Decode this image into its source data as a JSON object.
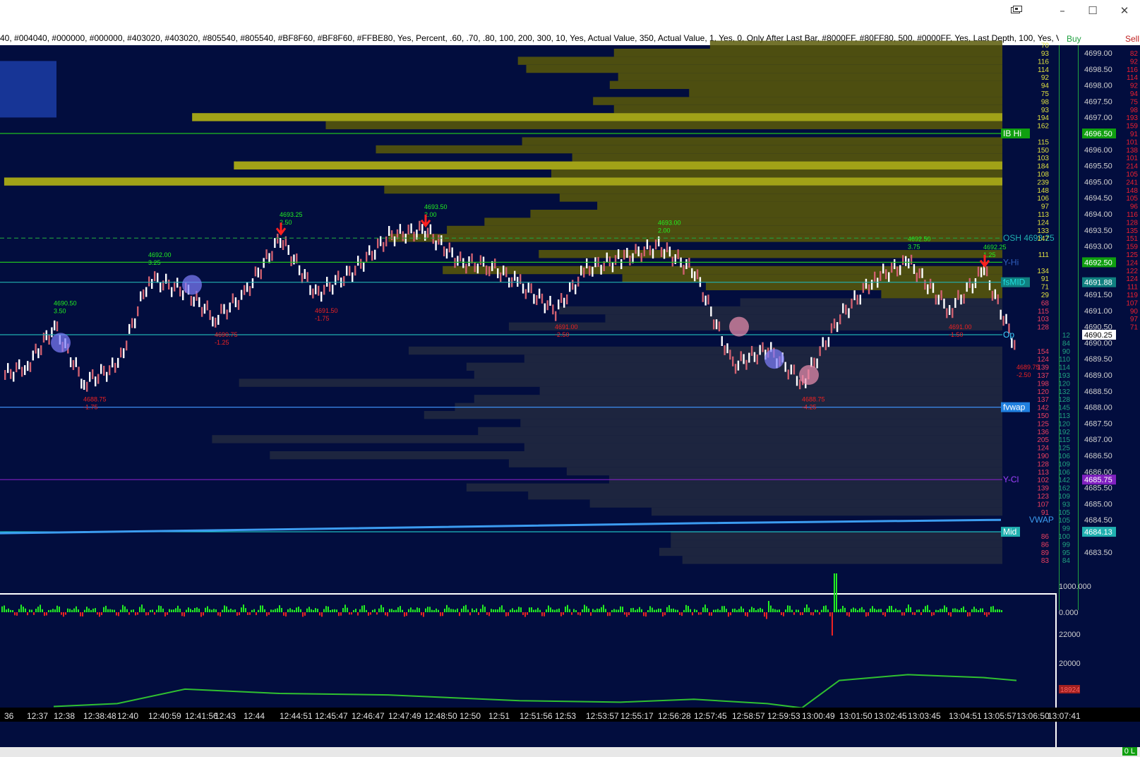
{
  "window": {
    "icon": "window-cascade-icon",
    "minimize": "–",
    "maximize": "☐",
    "close": "✕"
  },
  "settings_string": "40, #004040, #000000, #000000, #403020, #403020, #805540, #805540, #BF8F60, #BF8F60, #FFBE80, Yes, Percent, .60, .70, .80, 100, 200, 300, 10, Yes, Actual Value, 350, Actual Value, 1, Yes, 0, Only After Last Bar, #8000FF, #80FF80, 500, #0000FF, Yes, Last Depth, 100, Yes, Visible Bars, 0, 60, 1, (",
  "headers": {
    "buy": "Buy",
    "sell": "Sell"
  },
  "colors": {
    "background": "#020d3e",
    "profile": "#5a5a08",
    "profile_hot": "#bdbd10",
    "line_green": "#20c020",
    "line_cyan": "#20b0b0",
    "vwap": "#3c9cf0",
    "pos": "#22ee22",
    "neg": "#ee2222",
    "up": "#ffffff",
    "down": "#d06070"
  },
  "price_axis": [
    {
      "p": 4699.0,
      "t": "4699.00"
    },
    {
      "p": 4698.5,
      "t": "4698.50"
    },
    {
      "p": 4698.0,
      "t": "4698.00"
    },
    {
      "p": 4697.5,
      "t": "4697.50"
    },
    {
      "p": 4697.0,
      "t": "4697.00"
    },
    {
      "p": 4696.0,
      "t": "4696.00"
    },
    {
      "p": 4695.5,
      "t": "4695.50"
    },
    {
      "p": 4695.0,
      "t": "4695.00"
    },
    {
      "p": 4694.5,
      "t": "4694.50"
    },
    {
      "p": 4694.0,
      "t": "4694.00"
    },
    {
      "p": 4693.5,
      "t": "4693.50"
    },
    {
      "p": 4693.0,
      "t": "4693.00"
    },
    {
      "p": 4691.5,
      "t": "4691.50"
    },
    {
      "p": 4691.0,
      "t": "4691.00"
    },
    {
      "p": 4690.5,
      "t": "4690.50"
    },
    {
      "p": 4690.0,
      "t": "4690.00"
    },
    {
      "p": 4689.5,
      "t": "4689.50"
    },
    {
      "p": 4689.0,
      "t": "4689.00"
    },
    {
      "p": 4688.5,
      "t": "4688.50"
    },
    {
      "p": 4688.0,
      "t": "4688.00"
    },
    {
      "p": 4687.5,
      "t": "4687.50"
    },
    {
      "p": 4687.0,
      "t": "4687.00"
    },
    {
      "p": 4686.5,
      "t": "4686.50"
    },
    {
      "p": 4686.0,
      "t": "4686.00"
    },
    {
      "p": 4685.5,
      "t": "4685.50"
    },
    {
      "p": 4685.0,
      "t": "4685.00"
    },
    {
      "p": 4684.5,
      "t": "4684.50"
    },
    {
      "p": 4683.5,
      "t": "4683.50"
    }
  ],
  "price_tags": [
    {
      "p": 4696.5,
      "t": "4696.50",
      "bg": "#10a010",
      "fg": "#ffffff"
    },
    {
      "p": 4692.5,
      "t": "4692.50",
      "bg": "#10a010",
      "fg": "#ffffff"
    },
    {
      "p": 4691.88,
      "t": "4691.88",
      "bg": "#108080",
      "fg": "#ffffff"
    },
    {
      "p": 4690.25,
      "t": "4690.25",
      "bg": "#ffffff",
      "fg": "#000000"
    },
    {
      "p": 4685.75,
      "t": "4685.75",
      "bg": "#8020c0",
      "fg": "#ffffff"
    },
    {
      "p": 4684.13,
      "t": "4684.13",
      "bg": "#20b0b0",
      "fg": "#ffffff"
    }
  ],
  "ladder_vol": [
    {
      "p": 4699.25,
      "t": "70"
    },
    {
      "p": 4699.0,
      "t": "93"
    },
    {
      "p": 4698.75,
      "t": "116"
    },
    {
      "p": 4698.5,
      "t": "114"
    },
    {
      "p": 4698.25,
      "t": "92"
    },
    {
      "p": 4698.0,
      "t": "94"
    },
    {
      "p": 4697.75,
      "t": "75"
    },
    {
      "p": 4697.5,
      "t": "98"
    },
    {
      "p": 4697.25,
      "t": "93"
    },
    {
      "p": 4697.0,
      "t": "194"
    },
    {
      "p": 4696.75,
      "t": "162"
    },
    {
      "p": 4696.25,
      "t": "115"
    },
    {
      "p": 4696.0,
      "t": "150"
    },
    {
      "p": 4695.75,
      "t": "103"
    },
    {
      "p": 4695.5,
      "t": "184"
    },
    {
      "p": 4695.25,
      "t": "108"
    },
    {
      "p": 4695.0,
      "t": "239"
    },
    {
      "p": 4694.75,
      "t": "148"
    },
    {
      "p": 4694.5,
      "t": "106"
    },
    {
      "p": 4694.25,
      "t": "97"
    },
    {
      "p": 4694.0,
      "t": "113"
    },
    {
      "p": 4693.75,
      "t": "124"
    },
    {
      "p": 4693.5,
      "t": "133"
    },
    {
      "p": 4693.25,
      "t": "147"
    },
    {
      "p": 4692.75,
      "t": "111"
    },
    {
      "p": 4692.25,
      "t": "134"
    },
    {
      "p": 4692.0,
      "t": "91"
    },
    {
      "p": 4691.75,
      "t": "71"
    },
    {
      "p": 4691.5,
      "t": "29"
    }
  ],
  "bid_col": [
    {
      "p": 4691.25,
      "t": "68"
    },
    {
      "p": 4691.0,
      "t": "115"
    },
    {
      "p": 4690.75,
      "t": "103"
    },
    {
      "p": 4690.5,
      "t": "128"
    },
    {
      "p": 4689.75,
      "t": "154"
    },
    {
      "p": 4689.5,
      "t": "124"
    },
    {
      "p": 4689.25,
      "t": "139"
    },
    {
      "p": 4689.0,
      "t": "137"
    },
    {
      "p": 4688.75,
      "t": "198"
    },
    {
      "p": 4688.5,
      "t": "120"
    },
    {
      "p": 4688.25,
      "t": "137"
    },
    {
      "p": 4688.0,
      "t": "142"
    },
    {
      "p": 4687.75,
      "t": "150"
    },
    {
      "p": 4687.5,
      "t": "125"
    },
    {
      "p": 4687.25,
      "t": "136"
    },
    {
      "p": 4687.0,
      "t": "205"
    },
    {
      "p": 4686.75,
      "t": "124"
    },
    {
      "p": 4686.5,
      "t": "190"
    },
    {
      "p": 4686.25,
      "t": "128"
    },
    {
      "p": 4686.0,
      "t": "113"
    },
    {
      "p": 4685.75,
      "t": "102"
    },
    {
      "p": 4685.5,
      "t": "139"
    },
    {
      "p": 4685.25,
      "t": "123"
    },
    {
      "p": 4685.0,
      "t": "107"
    },
    {
      "p": 4684.75,
      "t": "91"
    },
    {
      "p": 4684.0,
      "t": "86"
    },
    {
      "p": 4683.75,
      "t": "86"
    },
    {
      "p": 4683.5,
      "t": "89"
    },
    {
      "p": 4683.25,
      "t": "83"
    }
  ],
  "ask_col": [
    {
      "p": 4690.25,
      "t": "12"
    },
    {
      "p": 4690.0,
      "t": "84"
    },
    {
      "p": 4689.75,
      "t": "90"
    },
    {
      "p": 4689.5,
      "t": "110"
    },
    {
      "p": 4689.25,
      "t": "114"
    },
    {
      "p": 4689.0,
      "t": "193"
    },
    {
      "p": 4688.75,
      "t": "120"
    },
    {
      "p": 4688.5,
      "t": "132"
    },
    {
      "p": 4688.25,
      "t": "128"
    },
    {
      "p": 4688.0,
      "t": "145"
    },
    {
      "p": 4687.75,
      "t": "113"
    },
    {
      "p": 4687.5,
      "t": "120"
    },
    {
      "p": 4687.25,
      "t": "192"
    },
    {
      "p": 4687.0,
      "t": "115"
    },
    {
      "p": 4686.75,
      "t": "125"
    },
    {
      "p": 4686.5,
      "t": "106"
    },
    {
      "p": 4686.25,
      "t": "109"
    },
    {
      "p": 4686.0,
      "t": "106"
    },
    {
      "p": 4685.75,
      "t": "142"
    },
    {
      "p": 4685.5,
      "t": "162"
    },
    {
      "p": 4685.25,
      "t": "109"
    },
    {
      "p": 4685.0,
      "t": "93"
    },
    {
      "p": 4684.75,
      "t": "105"
    },
    {
      "p": 4684.5,
      "t": "105"
    },
    {
      "p": 4684.25,
      "t": "99"
    },
    {
      "p": 4684.0,
      "t": "100"
    },
    {
      "p": 4683.75,
      "t": "99"
    },
    {
      "p": 4683.5,
      "t": "95"
    },
    {
      "p": 4683.25,
      "t": "84"
    }
  ],
  "sell_col": [
    {
      "p": 4699.0,
      "t": "82"
    },
    {
      "p": 4698.75,
      "t": "92"
    },
    {
      "p": 4698.5,
      "t": "116"
    },
    {
      "p": 4698.25,
      "t": "114"
    },
    {
      "p": 4698.0,
      "t": "92"
    },
    {
      "p": 4697.75,
      "t": "94"
    },
    {
      "p": 4697.5,
      "t": "75"
    },
    {
      "p": 4697.25,
      "t": "98"
    },
    {
      "p": 4697.0,
      "t": "193"
    },
    {
      "p": 4696.75,
      "t": "159"
    },
    {
      "p": 4696.5,
      "t": "91"
    },
    {
      "p": 4696.25,
      "t": "101"
    },
    {
      "p": 4696.0,
      "t": "138"
    },
    {
      "p": 4695.75,
      "t": "101"
    },
    {
      "p": 4695.5,
      "t": "214"
    },
    {
      "p": 4695.25,
      "t": "105"
    },
    {
      "p": 4695.0,
      "t": "241"
    },
    {
      "p": 4694.75,
      "t": "148"
    },
    {
      "p": 4694.5,
      "t": "105"
    },
    {
      "p": 4694.25,
      "t": "96"
    },
    {
      "p": 4694.0,
      "t": "116"
    },
    {
      "p": 4693.75,
      "t": "128"
    },
    {
      "p": 4693.5,
      "t": "135"
    },
    {
      "p": 4693.25,
      "t": "151"
    },
    {
      "p": 4693.0,
      "t": "159"
    },
    {
      "p": 4692.75,
      "t": "125"
    },
    {
      "p": 4692.5,
      "t": "124"
    },
    {
      "p": 4692.25,
      "t": "122"
    },
    {
      "p": 4692.0,
      "t": "124"
    },
    {
      "p": 4691.75,
      "t": "111"
    },
    {
      "p": 4691.5,
      "t": "119"
    },
    {
      "p": 4691.25,
      "t": "107"
    },
    {
      "p": 4691.0,
      "t": "90"
    },
    {
      "p": 4690.75,
      "t": "97"
    },
    {
      "p": 4690.5,
      "t": "71"
    }
  ],
  "levels": [
    {
      "p": 4696.5,
      "label": "IB Hi",
      "color": "#20c020",
      "dash": false,
      "label_bg": "#10a010",
      "label_fg": "#ffffff"
    },
    {
      "p": 4693.25,
      "label": "OSH  4693.25",
      "color": "#20a040",
      "dash": true,
      "label_bg": "",
      "label_fg": "#20b0b0"
    },
    {
      "p": 4692.5,
      "label": "Y-Hi",
      "color": "#20c020",
      "dash": false,
      "label_bg": "",
      "label_fg": "#3060c0"
    },
    {
      "p": 4691.88,
      "label": "fsMID",
      "color": "#20b0b0",
      "dash": false,
      "label_bg": "#108080",
      "label_fg": "#20e0e0"
    },
    {
      "p": 4690.25,
      "label": "Op",
      "color": "#20b0b0",
      "dash": false,
      "label_bg": "",
      "label_fg": "#40d0ff"
    },
    {
      "p": 4688.0,
      "label": "fvwap",
      "color": "#3c8cf0",
      "dash": false,
      "label_bg": "#2080e0",
      "label_fg": "#ffffff"
    },
    {
      "p": 4685.75,
      "label": "Y-Cl",
      "color": "#8020c0",
      "dash": false,
      "label_bg": "",
      "label_fg": "#a040ff"
    },
    {
      "p": 4684.13,
      "label": "Mid",
      "color": "#20d0d0",
      "dash": false,
      "label_bg": "#20b0b0",
      "label_fg": "#ffffff"
    }
  ],
  "vwap_label": "VWAP",
  "swing_labels": [
    {
      "time": "12:38",
      "p": 4690.5,
      "price": "4690.50",
      "delta": "3.50",
      "kind": "hi"
    },
    {
      "time": "12:38:48",
      "p": 4688.75,
      "price": "4688.75",
      "delta": "-1.75",
      "kind": "lo"
    },
    {
      "time": "12:40:59",
      "p": 4692.0,
      "price": "4692.00",
      "delta": "3.25",
      "kind": "hi"
    },
    {
      "time": "12:43",
      "p": 4690.75,
      "price": "4690.75",
      "delta": "-1.25",
      "kind": "lo"
    },
    {
      "time": "12:44:51",
      "p": 4693.25,
      "price": "4693.25",
      "delta": "2.50",
      "kind": "hi"
    },
    {
      "time": "12:45:47",
      "p": 4691.5,
      "price": "4691.50",
      "delta": "-1.75",
      "kind": "lo"
    },
    {
      "time": "12:48:50",
      "p": 4693.5,
      "price": "4693.50",
      "delta": "2.00",
      "kind": "hi"
    },
    {
      "time": "12:53",
      "p": 4691.0,
      "price": "4691.00",
      "delta": "-2.50",
      "kind": "lo"
    },
    {
      "time": "12:56:28",
      "p": 4693.0,
      "price": "4693.00",
      "delta": "2.00",
      "kind": "hi"
    },
    {
      "time": "13:00:49",
      "p": 4688.75,
      "price": "4688.75",
      "delta": "-4.25",
      "kind": "lo"
    },
    {
      "time": "13:03:45",
      "p": 4692.5,
      "price": "4692.50",
      "delta": "3.75",
      "kind": "hi"
    },
    {
      "time": "13:04:51",
      "p": 4691.0,
      "price": "4691.00",
      "delta": "-1.50",
      "kind": "lo"
    },
    {
      "time": "13:05:57",
      "p": 4692.25,
      "price": "4692.25",
      "delta": "1.25",
      "kind": "hi"
    },
    {
      "time": "13:06:50",
      "p": 4689.75,
      "price": "4689.75",
      "delta": "-2.50",
      "kind": "lo"
    }
  ],
  "time_axis": [
    "36",
    "12:37",
    "12:38",
    "12:38:48",
    "12:40",
    "12:40:59",
    "12:41:56",
    "12:43",
    "12:44",
    "12:44:51",
    "12:45:47",
    "12:46:47",
    "12:47:49",
    "12:48:50",
    "12:50",
    "12:51",
    "12:51:56",
    "12:53",
    "12:53:57",
    "12:55:17",
    "12:56:28",
    "12:57:45",
    "12:58:57",
    "12:59:53",
    "13:00:49",
    "13:01:50",
    "13:02:45",
    "13:03:45",
    "13:04:51",
    "13:05:57",
    "13:06:50",
    "13:07:41"
  ],
  "price_path": [
    {
      "t": "36",
      "p": 4689.0
    },
    {
      "t": "12:37",
      "p": 4689.3
    },
    {
      "t": "12:38",
      "p": 4690.5
    },
    {
      "t": "12:38:48",
      "p": 4688.75
    },
    {
      "t": "12:40",
      "p": 4689.3
    },
    {
      "t": "12:40:59",
      "p": 4692.0
    },
    {
      "t": "12:41:56",
      "p": 4691.6
    },
    {
      "t": "12:43",
      "p": 4690.75
    },
    {
      "t": "12:44",
      "p": 4691.5
    },
    {
      "t": "12:44:51",
      "p": 4693.25
    },
    {
      "t": "12:45:47",
      "p": 4691.5
    },
    {
      "t": "12:46:47",
      "p": 4692.2
    },
    {
      "t": "12:47:49",
      "p": 4693.3
    },
    {
      "t": "12:48:50",
      "p": 4693.5
    },
    {
      "t": "12:50",
      "p": 4692.5
    },
    {
      "t": "12:51",
      "p": 4692.4
    },
    {
      "t": "12:51:56",
      "p": 4691.8
    },
    {
      "t": "12:53",
      "p": 4691.0
    },
    {
      "t": "12:53:57",
      "p": 4692.3
    },
    {
      "t": "12:55:17",
      "p": 4692.6
    },
    {
      "t": "12:56:28",
      "p": 4693.0
    },
    {
      "t": "12:57:45",
      "p": 4692.2
    },
    {
      "t": "12:58:57",
      "p": 4689.3
    },
    {
      "t": "12:59:53",
      "p": 4689.8
    },
    {
      "t": "13:00:49",
      "p": 4688.75
    },
    {
      "t": "13:01:50",
      "p": 4690.8
    },
    {
      "t": "13:02:45",
      "p": 4692.0
    },
    {
      "t": "13:03:45",
      "p": 4692.5
    },
    {
      "t": "13:04:51",
      "p": 4691.0
    },
    {
      "t": "13:05:57",
      "p": 4692.25
    },
    {
      "t": "13:06:50",
      "p": 4689.75
    }
  ],
  "cumdelta_path": [
    {
      "t": "12:38",
      "v": 17000
    },
    {
      "t": "12:40",
      "v": 17200
    },
    {
      "t": "12:41:56",
      "v": 18200
    },
    {
      "t": "12:44:51",
      "v": 17900
    },
    {
      "t": "12:47:49",
      "v": 17800
    },
    {
      "t": "12:51:56",
      "v": 17400
    },
    {
      "t": "12:55:17",
      "v": 17300
    },
    {
      "t": "12:57:45",
      "v": 17500
    },
    {
      "t": "12:59:53",
      "v": 17200
    },
    {
      "t": "13:00:49",
      "v": 16900
    },
    {
      "t": "13:01:50",
      "v": 18800
    },
    {
      "t": "13:03:45",
      "v": 19200
    },
    {
      "t": "13:05:57",
      "v": 19000
    },
    {
      "t": "13:06:50",
      "v": 18800
    }
  ],
  "volume_axis": [
    {
      "v": 1000,
      "t": "1000.000"
    },
    {
      "v": 0,
      "t": "0.000"
    }
  ],
  "delta_axis": [
    {
      "v": 22000,
      "t": "22000"
    },
    {
      "v": 20000,
      "t": "20000"
    }
  ],
  "delta_last": "18924",
  "status_text": "0 L",
  "chart_data": {
    "type": "line",
    "title": "",
    "xlabel": "",
    "ylabel": "",
    "ylim": [
      4683.25,
      4699.25
    ],
    "x": [
      "36",
      "12:37",
      "12:38",
      "12:38:48",
      "12:40",
      "12:40:59",
      "12:41:56",
      "12:43",
      "12:44",
      "12:44:51",
      "12:45:47",
      "12:46:47",
      "12:47:49",
      "12:48:50",
      "12:50",
      "12:51",
      "12:51:56",
      "12:53",
      "12:53:57",
      "12:55:17",
      "12:56:28",
      "12:57:45",
      "12:58:57",
      "12:59:53",
      "13:00:49",
      "13:01:50",
      "13:02:45",
      "13:03:45",
      "13:04:51",
      "13:05:57",
      "13:06:50"
    ],
    "series": [
      {
        "values": [
          4689.0,
          4689.3,
          4690.5,
          4688.75,
          4689.3,
          4692.0,
          4691.6,
          4690.75,
          4691.5,
          4693.25,
          4691.5,
          4692.2,
          4693.3,
          4693.5,
          4692.5,
          4692.4,
          4691.8,
          4691.0,
          4692.3,
          4692.6,
          4693.0,
          4692.2,
          4689.3,
          4689.8,
          4688.75,
          4690.8,
          4692.0,
          4692.5,
          4691.0,
          4692.25,
          4689.75
        ]
      }
    ],
    "grid": false
  }
}
